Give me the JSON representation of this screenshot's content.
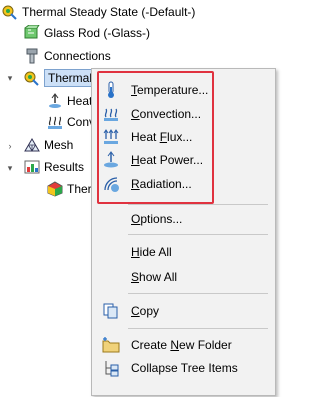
{
  "tree": {
    "root": "Thermal Steady State (-Default-)",
    "glass_rod": "Glass Rod (-Glass-)",
    "connections": "Connections",
    "thermal_loads": "Thermal L",
    "heat_child": "Heat",
    "conv_child": "Conv",
    "mesh": "Mesh",
    "results": "Results",
    "therm_child": "Therm"
  },
  "menu": {
    "temperature": {
      "accel": "T",
      "rest": "emperature..."
    },
    "convection": {
      "accel": "C",
      "rest": "onvection..."
    },
    "heat_flux": {
      "pre": "Heat ",
      "accel": "F",
      "rest": "lux..."
    },
    "heat_power": {
      "accel": "H",
      "rest": "eat Power..."
    },
    "radiation": {
      "accel": "R",
      "rest": "adiation..."
    },
    "options": {
      "accel": "O",
      "rest": "ptions..."
    },
    "hide_all": {
      "accel": "H",
      "rest": "ide All"
    },
    "show_all": {
      "accel": "S",
      "rest": "how All"
    },
    "copy": {
      "accel": "C",
      "rest": "opy"
    },
    "create_folder": {
      "pre": "Create ",
      "accel": "N",
      "rest": "ew Folder"
    },
    "collapse": "Collapse Tree Items"
  },
  "colors": {
    "highlight_border": "#e0323f",
    "selection_bg": "#cce0f7",
    "menu_bg": "#f2f2f2"
  }
}
